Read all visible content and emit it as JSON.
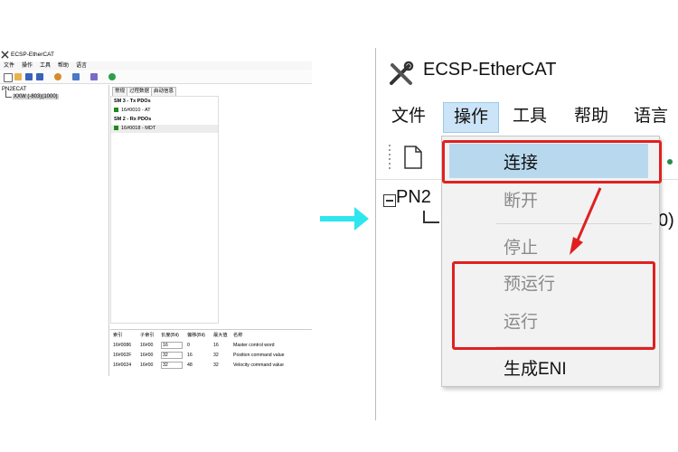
{
  "small_window": {
    "title": "ECSP-EtherCAT",
    "menu": [
      "文件",
      "操作",
      "工具",
      "帮助",
      "语言"
    ],
    "tree_root": "PN2ECAT",
    "tree_child": "XXW (-803)(1000)",
    "tabs": [
      "常规",
      "过程数据",
      "启动信息"
    ],
    "sm3_header": "SM 3 - Tx PDOs",
    "sm3_row": "16#0010  -  AT",
    "sm2_header": "SM 2 - Rx PDOs",
    "sm2_row": "16#0018  -  MDT",
    "table_headers": [
      "索引",
      "子索引",
      "长度(Bit)",
      "偏移(Bit)",
      "最大值",
      "名称"
    ],
    "table_rows": [
      [
        "16#0086",
        "16#00",
        "16",
        "0",
        "16",
        "Master control word"
      ],
      [
        "16#002F",
        "16#00",
        "32",
        "16",
        "32",
        "Position command value"
      ],
      [
        "16#0024",
        "16#00",
        "32",
        "48",
        "32",
        "Velocity command value"
      ]
    ]
  },
  "zoom_window": {
    "title": "ECSP-EtherCAT",
    "menu": [
      "文件",
      "操作",
      "工具",
      "帮助",
      "语言"
    ],
    "tree_root": "PN2",
    "tree_trailing": "0)",
    "dropdown": {
      "connect": "连接",
      "disconnect": "断开",
      "stop": "停止",
      "preop": "预运行",
      "run": "运行",
      "generate_eni": "生成ENI"
    }
  },
  "colors": {
    "arrow": "#2ee6ef",
    "highlight_box": "#e02020",
    "menu_selected": "#cce4f7",
    "item_hover": "#b8d8ee"
  }
}
